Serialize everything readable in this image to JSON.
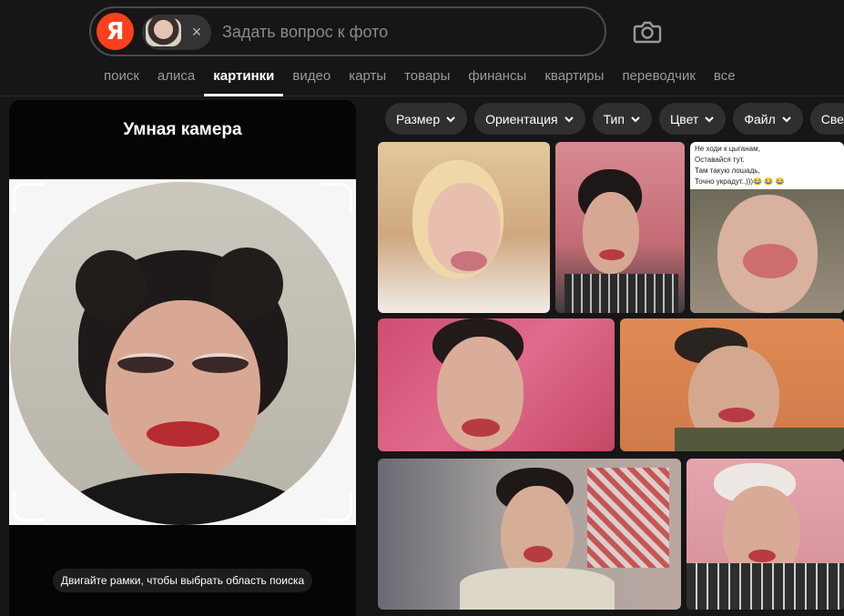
{
  "search": {
    "placeholder": "Задать вопрос к фото",
    "logo_text": "Я",
    "chip_close": "×"
  },
  "tabs": [
    {
      "label": "поиск",
      "active": false
    },
    {
      "label": "алиса",
      "active": false
    },
    {
      "label": "картинки",
      "active": true
    },
    {
      "label": "видео",
      "active": false
    },
    {
      "label": "карты",
      "active": false
    },
    {
      "label": "товары",
      "active": false
    },
    {
      "label": "финансы",
      "active": false
    },
    {
      "label": "квартиры",
      "active": false
    },
    {
      "label": "переводчик",
      "active": false
    },
    {
      "label": "все",
      "active": false
    }
  ],
  "smart_camera": {
    "title": "Умная камера",
    "hint": "Двигайте рамки, чтобы выбрать область поиска"
  },
  "filters": [
    "Размер",
    "Ориентация",
    "Тип",
    "Цвет",
    "Файл",
    "Све"
  ],
  "results": {
    "text_tile_lines": [
      "Не ходи к цыганам,",
      "Оставайся тут.",
      "Там такую лошадь,",
      "Точно украдут..)))😂 😂 😂"
    ]
  },
  "icons": {
    "camera": "camera-icon",
    "close": "close-icon",
    "chevron": "chevron-down-icon"
  },
  "colors": {
    "brand": "#fc3f1d",
    "background": "#161616",
    "panel": "#050505",
    "chip": "#2f2f2f"
  }
}
